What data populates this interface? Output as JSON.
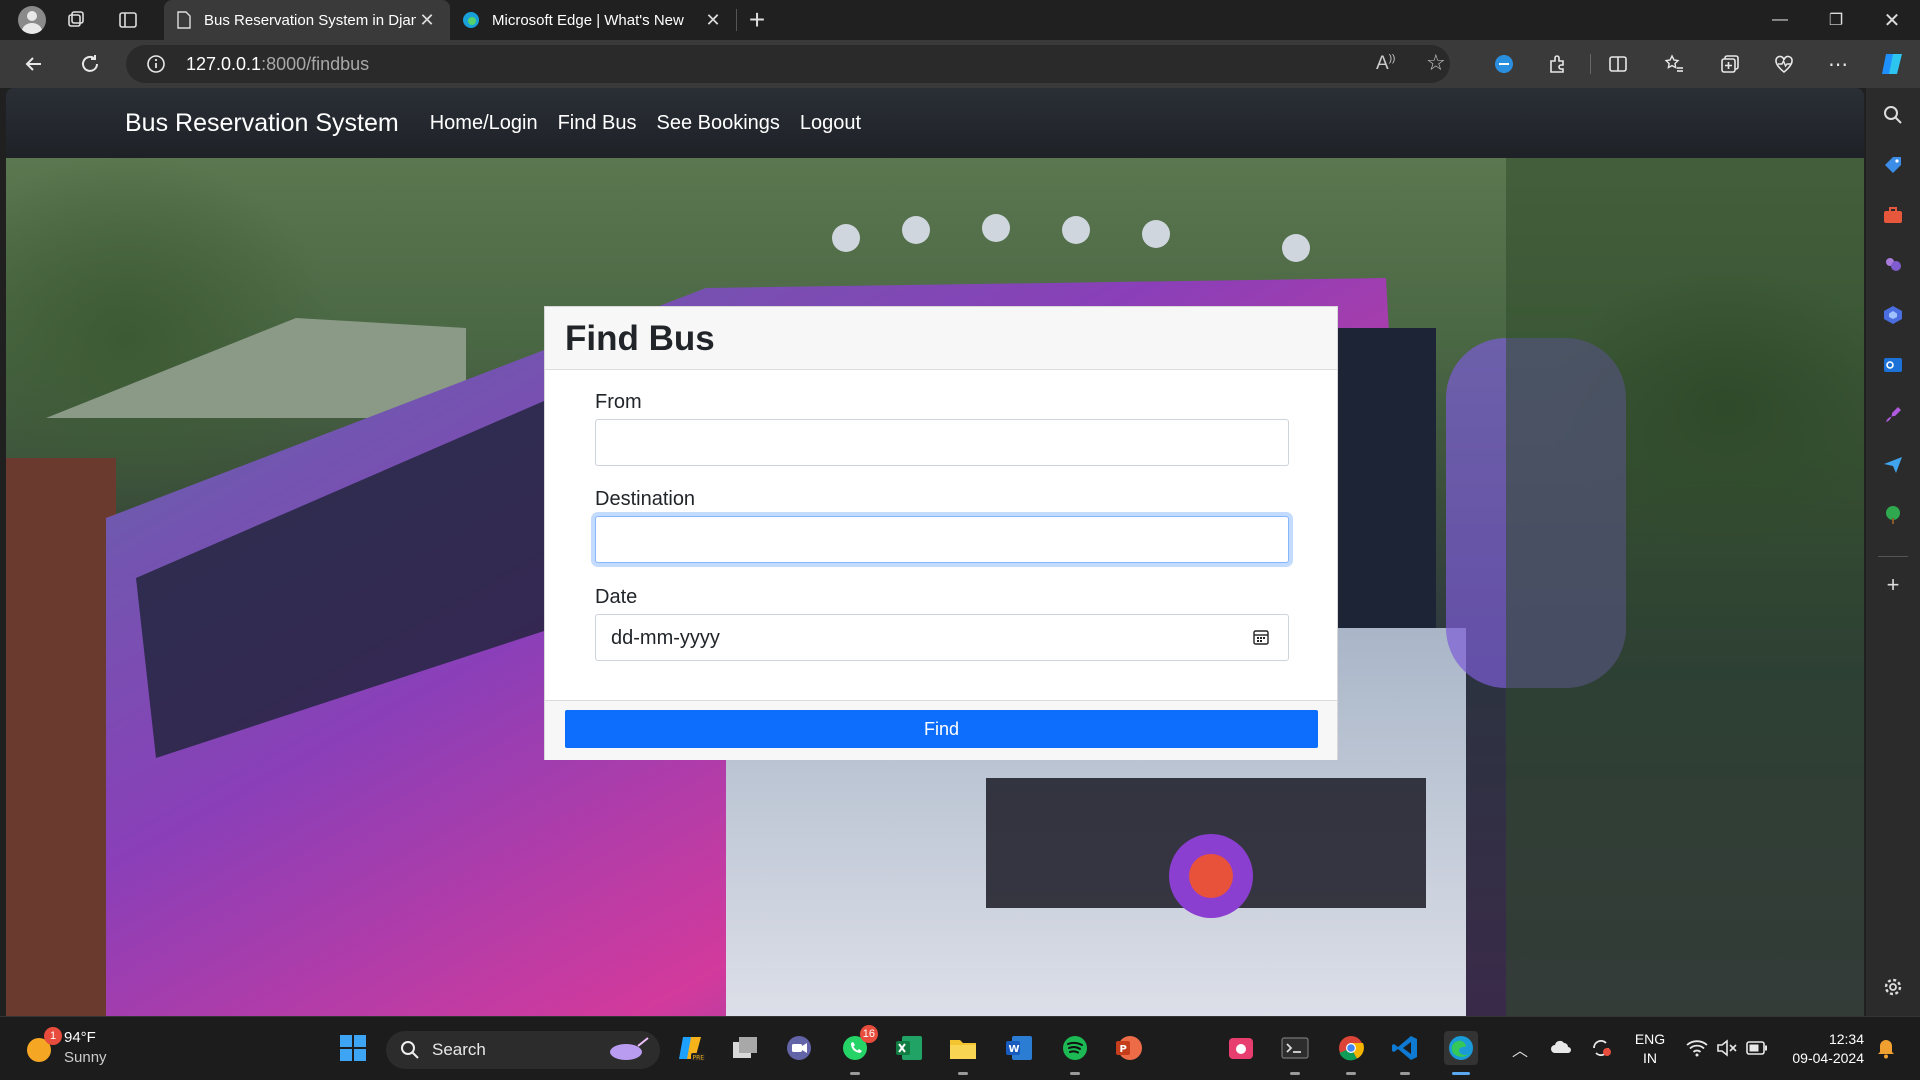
{
  "browser": {
    "tabs": [
      {
        "title": "Bus Reservation System in Djang",
        "active": true
      },
      {
        "title": "Microsoft Edge | What's New",
        "active": false
      }
    ],
    "url_host": "127.0.0.1",
    "url_path": ":8000/findbus"
  },
  "navbar": {
    "brand": "Bus Reservation System",
    "links": [
      "Home/Login",
      "Find Bus",
      "See Bookings",
      "Logout"
    ]
  },
  "form": {
    "title": "Find Bus",
    "from_label": "From",
    "from_value": "",
    "destination_label": "Destination",
    "destination_value": "",
    "date_label": "Date",
    "date_placeholder": "dd-mm-yyyy",
    "submit_label": "Find"
  },
  "taskbar": {
    "weather_temp": "94°F",
    "weather_desc": "Sunny",
    "weather_badge": "1",
    "search_label": "Search",
    "whatsapp_badge": "16",
    "lang_top": "ENG",
    "lang_bottom": "IN",
    "time": "12:34",
    "date": "09-04-2024"
  },
  "colors": {
    "primary": "#0d6efd",
    "navbar": "#212529",
    "browser_chrome": "#3a3a3a"
  }
}
